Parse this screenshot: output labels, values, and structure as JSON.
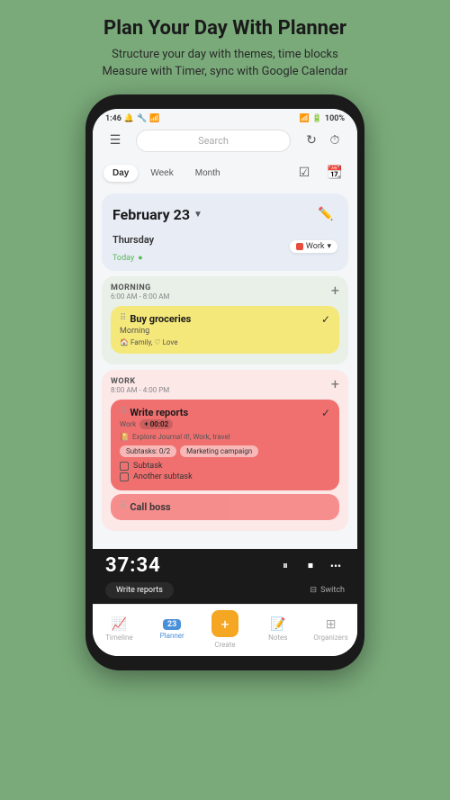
{
  "header": {
    "title": "Plan Your Day With Planner",
    "subtitle_line1": "Structure your day with themes, time blocks",
    "subtitle_line2": "Measure with Timer, sync with Google Calendar"
  },
  "status_bar": {
    "time": "1:46",
    "battery": "100%"
  },
  "top_bar": {
    "search_placeholder": "Search",
    "refresh_icon": "↻",
    "timer_icon": "⏱"
  },
  "tabs": {
    "day_label": "Day",
    "week_label": "Week",
    "month_label": "Month"
  },
  "date_section": {
    "date": "February 23",
    "day": "Thursday",
    "today": "Today",
    "work_label": "Work"
  },
  "morning_section": {
    "title": "MORNING",
    "time": "6:00 AM - 8:00 AM",
    "tasks": [
      {
        "name": "Buy groceries",
        "subtitle": "Morning",
        "tags": "🏠 Family, ♡ Love",
        "done": true
      }
    ]
  },
  "work_section": {
    "title": "WORK",
    "time": "8:00 AM - 4:00 PM",
    "tasks": [
      {
        "name": "Write reports",
        "subtitle": "Work",
        "timer": "+ 00:02",
        "tags": "Explore Journal it!, Work, travel",
        "subtask_count": "Subtasks: 0/2",
        "marketing": "Marketing campaign",
        "subtasks": [
          "Subtask",
          "Another subtask"
        ],
        "done": true
      }
    ]
  },
  "call_task": {
    "name": "Call boss"
  },
  "timer_bar": {
    "time": "37:34",
    "task_label": "Write reports",
    "switch_label": "Switch"
  },
  "bottom_nav": {
    "items": [
      {
        "icon": "📈",
        "label": "Timeline"
      },
      {
        "icon": "📅",
        "label": "Planner",
        "active": true,
        "badge": "23"
      },
      {
        "icon": "+",
        "label": "Create"
      },
      {
        "icon": "📝",
        "label": "Notes"
      },
      {
        "icon": "⊞",
        "label": "Organizers"
      }
    ]
  }
}
